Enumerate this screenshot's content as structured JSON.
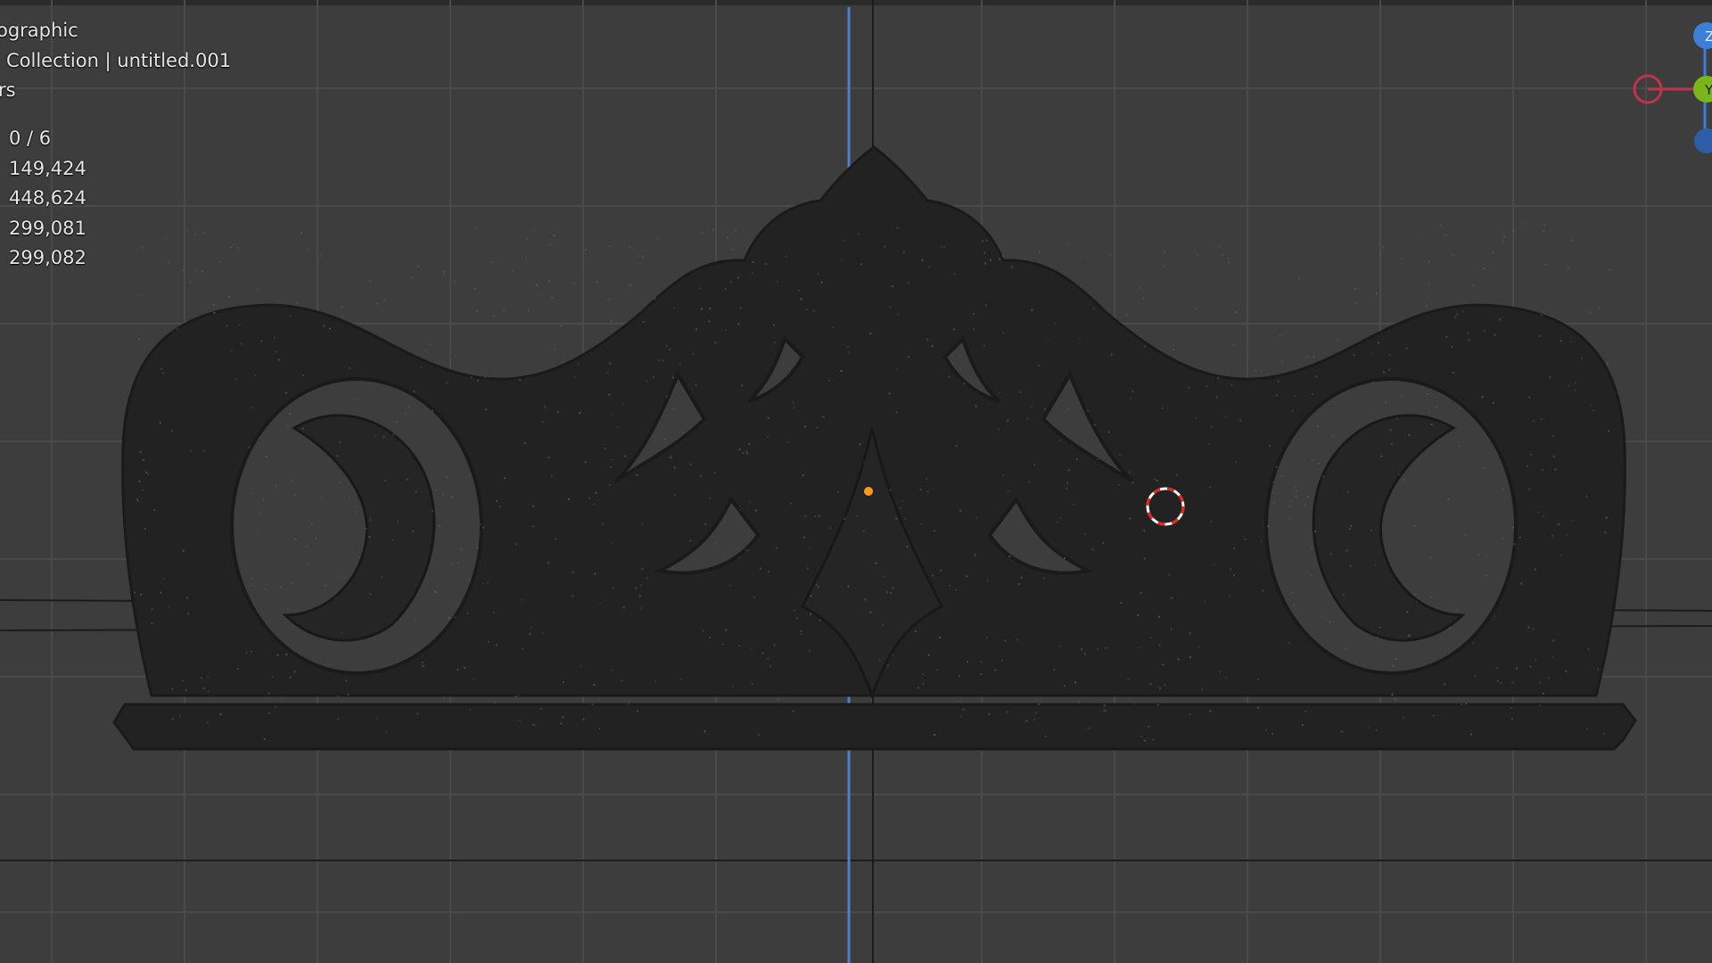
{
  "viewport": {
    "header_text": "ographic",
    "collection_text": "Collection | untitled.001",
    "overlay_fragment": "rs",
    "stats": [
      {
        "value": "0 / 6"
      },
      {
        "value": "149,424"
      },
      {
        "value": "448,624"
      },
      {
        "value": "299,081"
      },
      {
        "value": "299,082"
      }
    ]
  },
  "gizmo": {
    "z_label": "Z",
    "y_label": "Y",
    "colors": {
      "x": "#c0334a",
      "y": "#7ab51c",
      "z": "#3b7fd6"
    }
  },
  "colors": {
    "background": "#3d3d3d",
    "grid": "#4a4a4a",
    "ornament": "#202020",
    "blue_axis": "#4b7fd0",
    "origin": "#ff9a1a"
  }
}
